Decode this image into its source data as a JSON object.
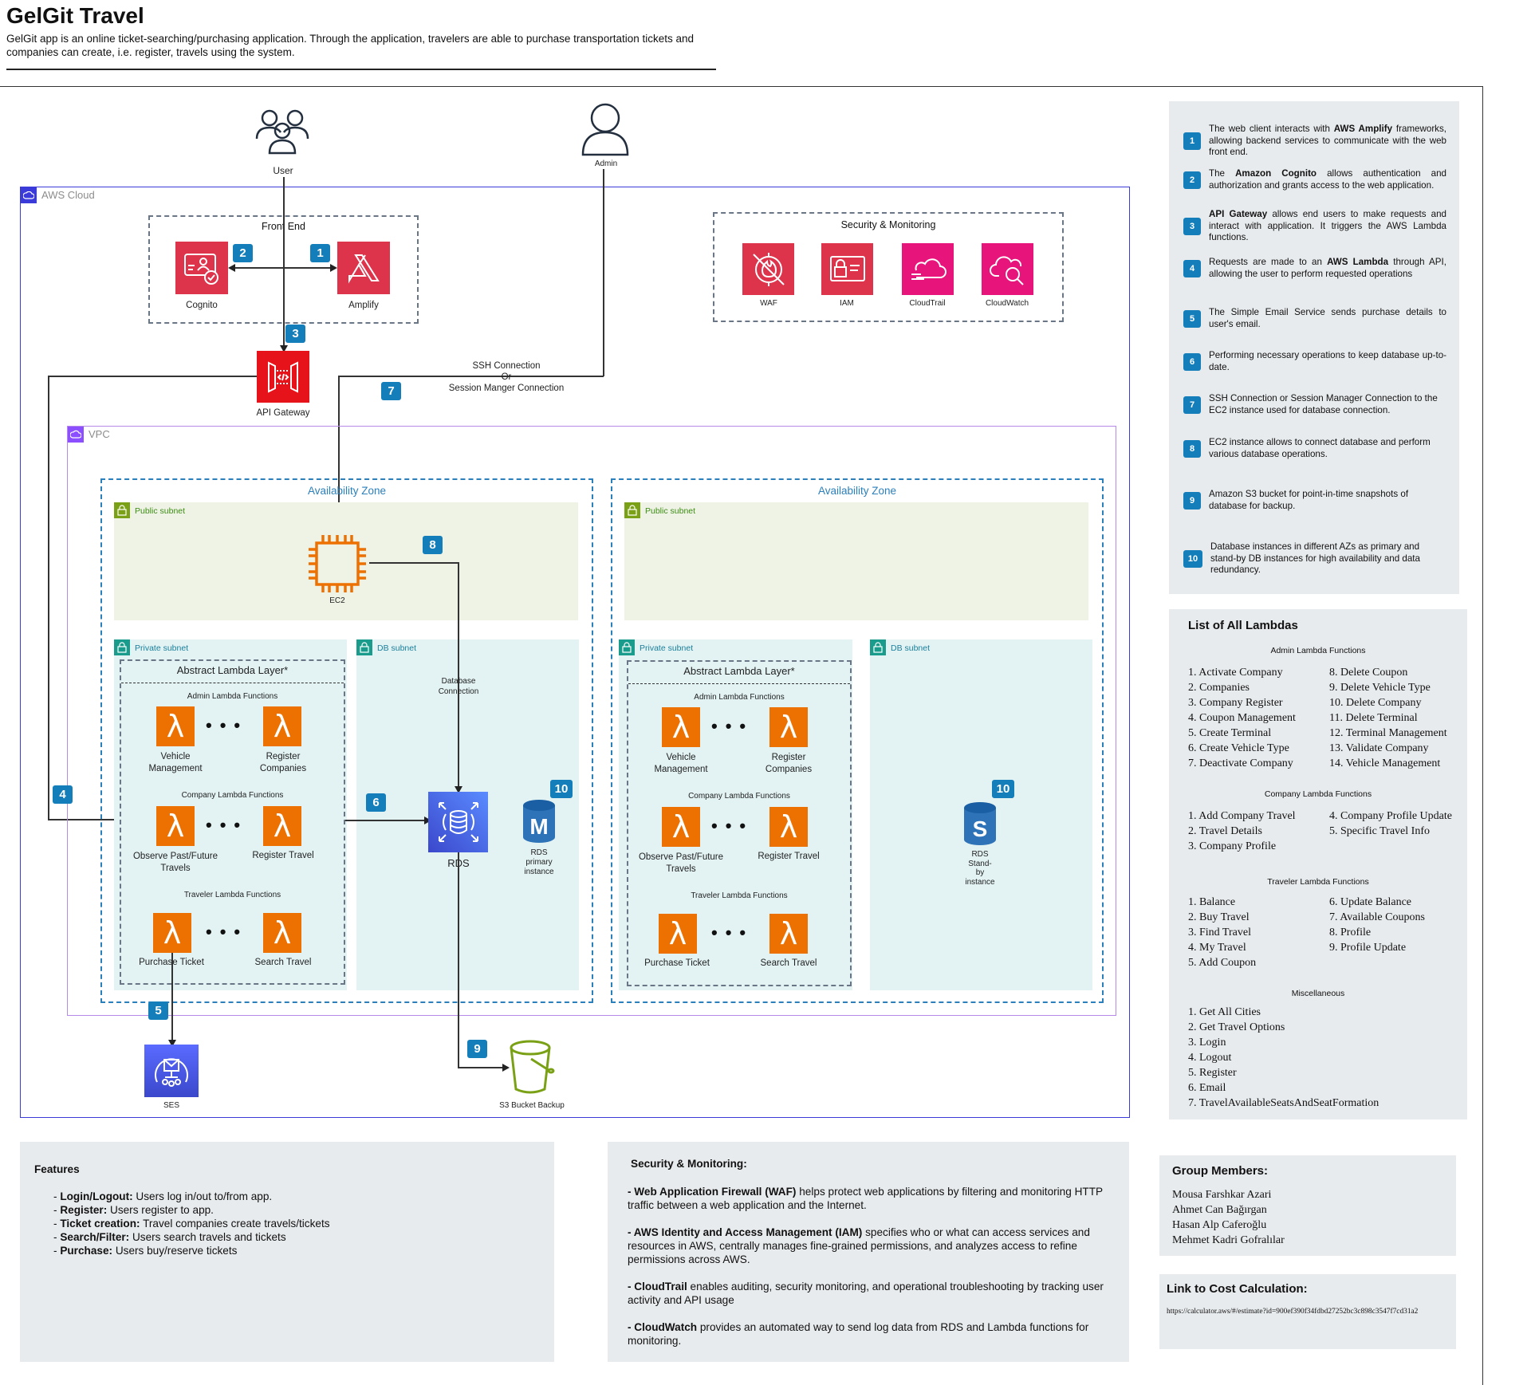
{
  "header": {
    "title": "GelGit Travel",
    "subtitle": "GelGit app is an online ticket-searching/purchasing application. Through the application, travelers are able to purchase transportation tickets and companies can create, i.e. register, travels using the system."
  },
  "diagram": {
    "actors": {
      "user": "User",
      "admin": "Admin"
    },
    "aws_cloud_label": "AWS Cloud",
    "vpc_label": "VPC",
    "front_end": {
      "label": "Front End",
      "cognito": "Cognito",
      "amplify": "Amplify"
    },
    "api_gateway": "API Gateway",
    "ssh_label": [
      "SSH Connection",
      "Or",
      "Session Manger Connection"
    ],
    "security_group": {
      "label": "Security & Monitoring",
      "waf": "WAF",
      "iam": "IAM",
      "cloudtrail": "CloudTrail",
      "cloudwatch": "CloudWatch"
    },
    "availability_zone": "Availability Zone",
    "public_subnet": "Public subnet",
    "private_subnet": "Private subnet",
    "db_subnet": "DB subnet",
    "ec2": "EC2",
    "db_connection": [
      "Database",
      "Connection"
    ],
    "rds": "RDS",
    "rds_primary": [
      "RDS",
      "primary",
      "instance"
    ],
    "rds_standby": [
      "RDS",
      "Stand-",
      "by",
      "instance"
    ],
    "lambda_layer": {
      "title": "Abstract Lambda Layer*",
      "admin_title": "Admin Lambda Functions",
      "admin_left": [
        "Vehicle",
        "Management"
      ],
      "admin_right": [
        "Register",
        "Companies"
      ],
      "company_title": "Company Lambda Functions",
      "company_left": [
        "Observe Past/Future",
        "Travels"
      ],
      "company_right": "Register Travel",
      "traveler_title": "Traveler Lambda Functions",
      "traveler_left": "Purchase Ticket",
      "traveler_right": "Search Travel"
    },
    "ses": "SES",
    "s3": "S3 Bucket Backup",
    "badges": [
      "1",
      "2",
      "3",
      "4",
      "5",
      "6",
      "7",
      "8",
      "9",
      "10"
    ]
  },
  "steps": [
    {
      "num": "1",
      "pre": "The web client interacts with ",
      "bold": "AWS Amplify",
      "post": " frameworks, allowing backend services to communicate with the web front end."
    },
    {
      "num": "2",
      "pre": "The ",
      "bold": "Amazon Cognito",
      "post": " allows authentication and authorization and grants access to the web application."
    },
    {
      "num": "3",
      "pre": "",
      "bold": "API Gateway",
      "post": " allows end users to make requests and interact with application. It triggers the AWS Lambda functions."
    },
    {
      "num": "4",
      "pre": "Requests are made to an ",
      "bold": "AWS Lambda",
      "post": " through API, allowing the user to perform requested operations"
    },
    {
      "num": "5",
      "pre": "The Simple Email Service sends purchase details to user's email.",
      "bold": "",
      "post": ""
    },
    {
      "num": "6",
      "pre": "Performing necessary operations to keep database up-to-date.",
      "bold": "",
      "post": ""
    },
    {
      "num": "7",
      "pre": "SSH Connection or Session Manager Connection to the EC2 instance used for database connection.",
      "bold": "",
      "post": ""
    },
    {
      "num": "8",
      "pre": "EC2 instance allows to connect database and perform various database operations.",
      "bold": "",
      "post": ""
    },
    {
      "num": "9",
      "pre": "Amazon S3 bucket for point-in-time snapshots of database for backup.",
      "bold": "",
      "post": ""
    },
    {
      "num": "10",
      "pre": "Database instances in different AZs as primary and stand-by DB instances for high availability and data redundancy.",
      "bold": "",
      "post": ""
    }
  ],
  "lambda_list": {
    "title": "List of All Lambdas",
    "admin": {
      "title": "Admin Lambda Functions",
      "col1": [
        "1. Activate Company",
        "2. Companies",
        "3. Company Register",
        "4. Coupon Management",
        "5. Create Terminal",
        "6. Create Vehicle Type",
        "7. Deactivate Company"
      ],
      "col2": [
        "8. Delete Coupon",
        "9. Delete Vehicle Type",
        "10. Delete Company",
        "11. Delete Terminal",
        "12. Terminal Management",
        "13. Validate Company",
        "14. Vehicle Management"
      ]
    },
    "company": {
      "title": "Company Lambda Functions",
      "col1": [
        "1. Add Company Travel",
        "2. Travel Details",
        "3. Company Profile"
      ],
      "col2": [
        "4. Company Profile Update",
        "5. Specific Travel Info"
      ]
    },
    "traveler": {
      "title": "Traveler Lambda Functions",
      "col1": [
        "1. Balance",
        "2. Buy Travel",
        "3. Find Travel",
        "4. My Travel",
        "5. Add Coupon"
      ],
      "col2": [
        "6. Update Balance",
        "7. Available Coupons",
        "8. Profile",
        "9. Profile Update"
      ]
    },
    "misc": {
      "title": "Miscellaneous",
      "col1": [
        "1. Get All Cities",
        "2. Get Travel Options",
        "3. Login",
        "4. Logout",
        "5. Register",
        "6. Email",
        "7. TravelAvailableSeatsAndSeatFormation"
      ]
    }
  },
  "features": {
    "title": "Features",
    "items": [
      {
        "bold": "Login/Logout:",
        "text": " Users log in/out to/from app."
      },
      {
        "bold": "Register:",
        "text": " Users register to app."
      },
      {
        "bold": "Ticket creation:",
        "text": " Travel companies create travels/tickets"
      },
      {
        "bold": "Search/Filter:",
        "text": " Users search travels and tickets"
      },
      {
        "bold": "Purchase:",
        "text": " Users buy/reserve tickets"
      }
    ]
  },
  "security": {
    "title": "Security & Monitoring:",
    "items": [
      {
        "bold": "- Web Application Firewall (WAF)",
        "text": " helps protect web applications by filtering and monitoring HTTP traffic between a web application and the Internet."
      },
      {
        "bold": "- AWS Identity and Access Management (IAM)",
        "text": " specifies who or what can access services and resources in AWS, centrally manages fine-grained permissions, and analyzes access to refine permissions across AWS."
      },
      {
        "bold": "- CloudTrail",
        "text": " enables auditing, security monitoring, and operational troubleshooting by tracking user activity and API usage"
      },
      {
        "bold": "- CloudWatch",
        "text": " provides an automated way to send log data from RDS and Lambda functions for monitoring."
      }
    ]
  },
  "group": {
    "title": "Group Members:",
    "members": [
      "Mousa Farshkar Azari",
      "Ahmet Can Bağırgan",
      "Hasan Alp Caferoğlu",
      "Mehmet Kadri Gofralılar"
    ]
  },
  "cost": {
    "title": "Link to Cost Calculation:",
    "url": "https://calculator.aws/#/estimate?id=900ef390f34fdbd27252bc3c898c3547f7cd31a2"
  },
  "colors": {
    "badge": "#147eba",
    "lambda": "#ed7100",
    "security_red": "#dd344c",
    "management_pink": "#e7157b",
    "api_red": "#e7131a",
    "rds_blue": "#4d72f3",
    "ses_blue": "#3b48cc",
    "s3_green": "#7aa116",
    "aws_cloud_border": "#3b3bd9",
    "vpc_border": "#b689e8",
    "az_border": "#2b7fba",
    "panel_bg": "#e8ebed"
  }
}
